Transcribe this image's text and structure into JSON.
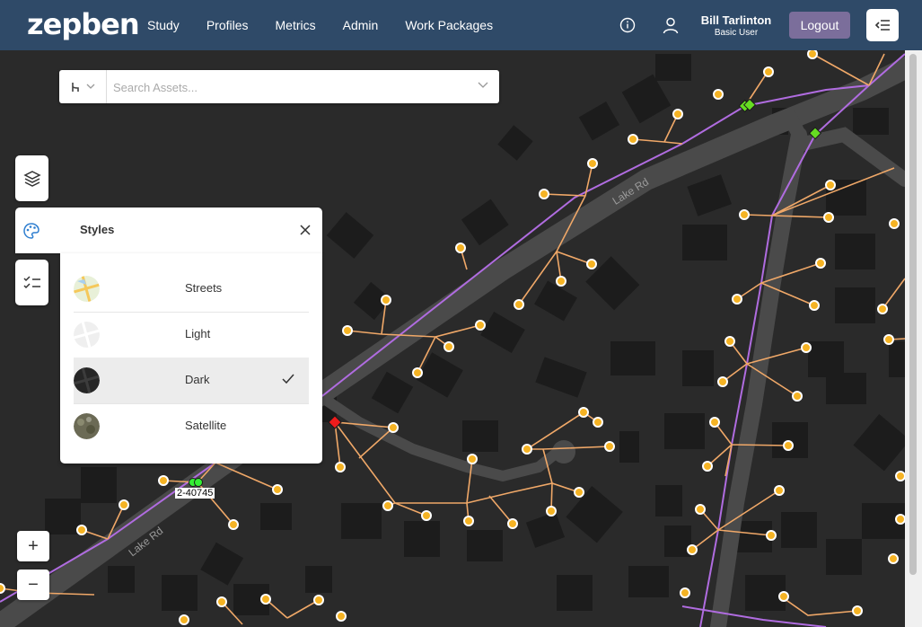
{
  "header": {
    "logo": "zepben",
    "nav": [
      "Study",
      "Profiles",
      "Metrics",
      "Admin",
      "Work Packages"
    ],
    "user_name": "Bill Tarlinton",
    "user_role": "Basic User",
    "logout_label": "Logout",
    "icons": [
      "info-icon",
      "user-icon",
      "panel-collapse-icon"
    ]
  },
  "search": {
    "placeholder": "Search Assets...",
    "value": "",
    "type_icon": "network-trace-icon"
  },
  "tools": [
    "layers-icon",
    "palette-icon",
    "checklist-icon"
  ],
  "styles_panel": {
    "title": "Styles",
    "options": [
      {
        "label": "Streets",
        "selected": false
      },
      {
        "label": "Light",
        "selected": false
      },
      {
        "label": "Dark",
        "selected": true
      },
      {
        "label": "Satellite",
        "selected": false
      }
    ]
  },
  "map": {
    "road_labels": [
      "Lake Rd",
      "Lake Rd"
    ],
    "asset_label": "2-40745"
  },
  "zoom": {
    "in_label": "+",
    "out_label": "−"
  },
  "colors": {
    "header": "#2f4a68",
    "logout": "#7b6e9b",
    "map_bg": "#2a2a2a",
    "road": "#4a4a4a",
    "feeder_line": "#b06ce0",
    "service_line": "#f0a868",
    "node": "#f5b324",
    "switch_green": "#66dd22",
    "switch_red": "#ee1c1c"
  }
}
